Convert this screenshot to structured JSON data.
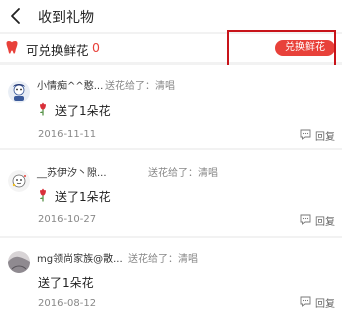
{
  "header": {
    "title": "收到礼物"
  },
  "summary": {
    "label": "可兑换鲜花",
    "count": "0",
    "exchange_button": "兑换鲜花"
  },
  "items": [
    {
      "sender": "小情痴^^憨...",
      "sent_to": "送花给了：清唱",
      "gift": "送了1朵花",
      "date": "2016-11-11",
      "reply": "回复"
    },
    {
      "sender": "__苏伊汐丶隙...",
      "sent_to": "送花给了：清唱",
      "gift": "送了1朵花",
      "date": "2016-10-27",
      "reply": "回复"
    },
    {
      "sender": "mg领尚家族@散...",
      "sent_to": "送花给了：清唱",
      "gift": "送了1朵花",
      "date": "2016-08-12",
      "reply": "回复"
    }
  ],
  "colors": {
    "accent": "#e8413a",
    "highlight_box": "#c8141a",
    "background": "#f2f2f2"
  },
  "icons": [
    "back-icon",
    "tooth-icon",
    "flower-icon",
    "reply-icon"
  ]
}
